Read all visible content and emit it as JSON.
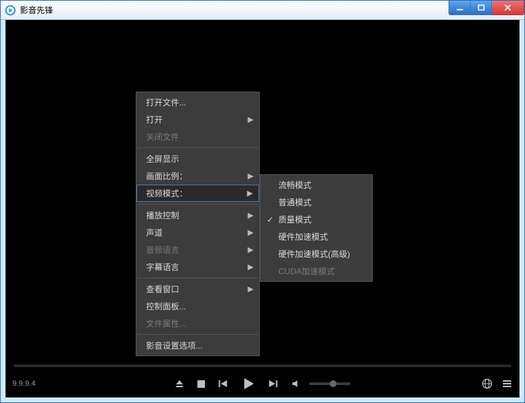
{
  "window": {
    "title": "影音先锋"
  },
  "logo": "play",
  "version": "9.9.9.4",
  "menu": {
    "items": [
      {
        "label": "打开文件...",
        "disabled": false,
        "sub": false
      },
      {
        "label": "打开",
        "disabled": false,
        "sub": true
      },
      {
        "label": "关闭文件",
        "disabled": true,
        "sub": false
      },
      {
        "sep": true
      },
      {
        "label": "全屏显示",
        "disabled": false,
        "sub": false
      },
      {
        "label": "画面比例：",
        "disabled": false,
        "sub": true
      },
      {
        "label": "视频模式：",
        "disabled": false,
        "sub": true,
        "highlight": true
      },
      {
        "sep": true
      },
      {
        "label": "播放控制",
        "disabled": false,
        "sub": true
      },
      {
        "label": "声道",
        "disabled": false,
        "sub": true
      },
      {
        "label": "音频语言",
        "disabled": true,
        "sub": true
      },
      {
        "label": "字幕语言",
        "disabled": false,
        "sub": true
      },
      {
        "sep": true
      },
      {
        "label": "查看窗口",
        "disabled": false,
        "sub": true
      },
      {
        "label": "控制面板...",
        "disabled": false,
        "sub": false
      },
      {
        "label": "文件属性...",
        "disabled": true,
        "sub": false
      },
      {
        "sep": true
      },
      {
        "label": "影音设置选项...",
        "disabled": false,
        "sub": false
      }
    ]
  },
  "submenu": {
    "items": [
      {
        "label": "流畅模式",
        "checked": false,
        "disabled": false
      },
      {
        "label": "普通模式",
        "checked": false,
        "disabled": false
      },
      {
        "label": "质量模式",
        "checked": true,
        "disabled": false
      },
      {
        "label": "硬件加速模式",
        "checked": false,
        "disabled": false
      },
      {
        "label": "硬件加速模式(高级)",
        "checked": false,
        "disabled": false
      },
      {
        "label": "CUDA加速模式",
        "checked": false,
        "disabled": true
      }
    ]
  }
}
